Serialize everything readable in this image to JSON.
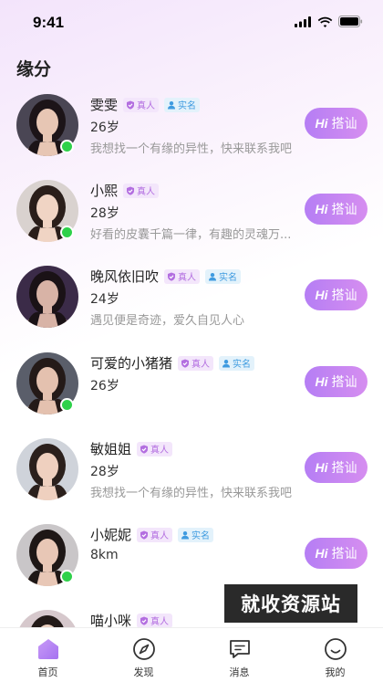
{
  "status_bar": {
    "time": "9:41"
  },
  "page_title": "缘分",
  "badges": {
    "real": "真人",
    "id": "实名"
  },
  "greet_button": {
    "hi": "Hi",
    "label": "搭讪"
  },
  "users": [
    {
      "name": "雯雯",
      "meta": "26岁",
      "bio": "我想找一个有缘的异性，快来联系我吧",
      "verified_real": true,
      "verified_id": true,
      "online": true
    },
    {
      "name": "小熙",
      "meta": "28岁",
      "bio": "好看的皮囊千篇一律，有趣的灵魂万...",
      "verified_real": true,
      "verified_id": false,
      "online": true
    },
    {
      "name": "晚风依旧吹",
      "meta": "24岁",
      "bio": "遇见便是奇迹，爱久自见人心",
      "verified_real": true,
      "verified_id": true,
      "online": false
    },
    {
      "name": "可爱的小猪猪",
      "meta": "26岁",
      "bio": "",
      "verified_real": true,
      "verified_id": true,
      "online": true
    },
    {
      "name": "敏姐姐",
      "meta": "28岁",
      "bio": "我想找一个有缘的异性，快来联系我吧",
      "verified_real": true,
      "verified_id": false,
      "online": false
    },
    {
      "name": "小妮妮",
      "meta": "8km",
      "bio": "",
      "verified_real": true,
      "verified_id": true,
      "online": true
    },
    {
      "name": "喵小咪",
      "meta": "",
      "bio": "",
      "verified_real": true,
      "verified_id": false,
      "online": false
    }
  ],
  "watermark": "就收资源站",
  "tabs": [
    {
      "label": "首页",
      "icon": "home-icon",
      "active": true
    },
    {
      "label": "发现",
      "icon": "compass-icon",
      "active": false
    },
    {
      "label": "消息",
      "icon": "message-icon",
      "active": false
    },
    {
      "label": "我的",
      "icon": "profile-icon",
      "active": false
    }
  ],
  "colors": {
    "accent": "#b57ef4",
    "online": "#2ed14a",
    "badge_real": "#b36ee0",
    "badge_id": "#3f9be0"
  }
}
